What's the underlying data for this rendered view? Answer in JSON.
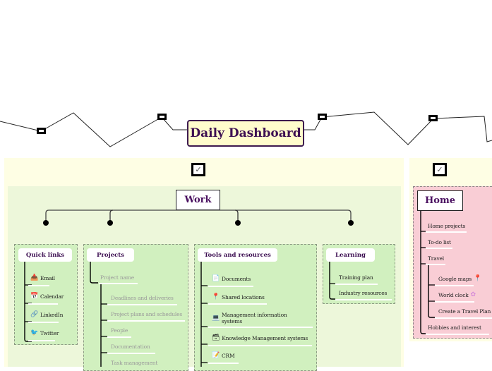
{
  "central": {
    "title": "Daily Dashboard"
  },
  "work": {
    "title": "Work",
    "checkbox": "✓",
    "groups": {
      "quick_links": {
        "title": "Quick links",
        "items": [
          {
            "label": "Email",
            "icon": "email-icon"
          },
          {
            "label": "Calendar",
            "icon": "calendar-icon"
          },
          {
            "label": "LinkedIn",
            "icon": "link-icon"
          },
          {
            "label": "Twitter",
            "icon": "twitter-bird-icon"
          }
        ]
      },
      "projects": {
        "title": "Projects",
        "parent": "Project name",
        "items": [
          {
            "label": "Deadlines and deliveries"
          },
          {
            "label": "Project plans and schedules"
          },
          {
            "label": "People"
          },
          {
            "label": "Documentation"
          },
          {
            "label": "Task management"
          }
        ]
      },
      "tools": {
        "title": "Tools and resources",
        "items": [
          {
            "label": "Documents",
            "icon": "document-icon"
          },
          {
            "label": "Shared locations",
            "icon": "pin-icon"
          },
          {
            "label": "Management information systems",
            "icon": "computer-icon"
          },
          {
            "label": "Knowledge Management systems",
            "icon": "file-cabinet-icon"
          },
          {
            "label": "CRM",
            "icon": "notepad-icon"
          }
        ]
      },
      "learning": {
        "title": "Learning",
        "items": [
          {
            "label": "Training plan"
          },
          {
            "label": "Industry resources"
          }
        ]
      }
    }
  },
  "home": {
    "title": "Home",
    "checkbox": "✓",
    "items": [
      {
        "label": "Home projects"
      },
      {
        "label": "To-do list"
      },
      {
        "label": "Travel"
      },
      {
        "label": "Hobbies and interest"
      }
    ],
    "travel_items": [
      {
        "label": "Google maps",
        "icon": "google-maps-icon"
      },
      {
        "label": "World clock",
        "icon": "world-clock-icon"
      },
      {
        "label": "Create a Travel Plan"
      }
    ]
  },
  "icons": {
    "email-icon": "📥",
    "calendar-icon": "📅",
    "link-icon": "🔗",
    "twitter-bird-icon": "🐦",
    "document-icon": "📄",
    "pin-icon": "📍",
    "computer-icon": "💻",
    "file-cabinet-icon": "🗃",
    "notepad-icon": "📝",
    "google-maps-icon": "📍",
    "world-clock-icon": "✿"
  }
}
